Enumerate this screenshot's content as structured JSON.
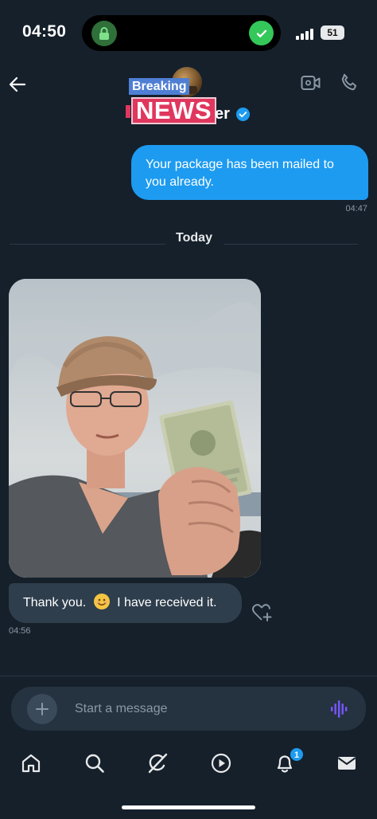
{
  "status_bar": {
    "time": "04:50",
    "battery": "51"
  },
  "header": {
    "overlay_top": "Breaking",
    "overlay_bottom": "NEWS",
    "name_visible": "er",
    "icons": [
      "back-arrow-icon",
      "verified-badge-icon",
      "video-call-icon",
      "phone-icon"
    ]
  },
  "messages": {
    "outgoing": {
      "text": "Your package has been mailed to you already.",
      "time": "04:47"
    },
    "day_divider": "Today",
    "incoming": {
      "text_before": "Thank you.",
      "emoji": "smiling-face-icon",
      "text_after": "I have received it.",
      "time": "04:56"
    }
  },
  "composer": {
    "placeholder": "Start a message"
  },
  "nav": {
    "items": [
      "home-icon",
      "search-icon",
      "grok-icon",
      "video-icon",
      "notifications-icon",
      "messages-icon"
    ],
    "notification_count": "1"
  },
  "colors": {
    "background": "#15202b",
    "accent": "#1d9bf0",
    "bubble_in": "#2f3e4d",
    "news_red": "#e0375e",
    "breaking_blue": "#4f7fd4"
  }
}
